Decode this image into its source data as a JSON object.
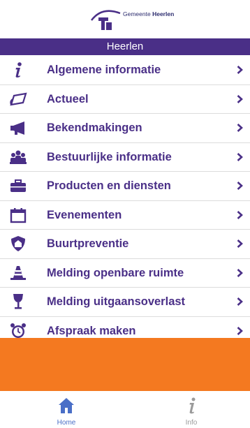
{
  "logo": {
    "prefix": "Gemeente",
    "name": "Heerlen"
  },
  "header": {
    "title": "Heerlen"
  },
  "menu": [
    {
      "label": "Algemene informatie",
      "icon": "info-icon"
    },
    {
      "label": "Actueel",
      "icon": "newspaper-icon"
    },
    {
      "label": "Bekendmakingen",
      "icon": "megaphone-icon"
    },
    {
      "label": "Bestuurlijke informatie",
      "icon": "group-icon"
    },
    {
      "label": "Producten en diensten",
      "icon": "briefcase-icon"
    },
    {
      "label": "Evenementen",
      "icon": "calendar-icon"
    },
    {
      "label": "Buurtpreventie",
      "icon": "house-shield-icon"
    },
    {
      "label": "Melding openbare ruimte",
      "icon": "traffic-cone-icon"
    },
    {
      "label": "Melding uitgaansoverlast",
      "icon": "glass-icon"
    },
    {
      "label": "Afspraak maken",
      "icon": "alarm-clock-icon"
    }
  ],
  "tabs": {
    "home": "Home",
    "info": "Info"
  },
  "colors": {
    "purple": "#4a2f87",
    "orange": "#f47920",
    "tab_active": "#4a6fc7"
  }
}
